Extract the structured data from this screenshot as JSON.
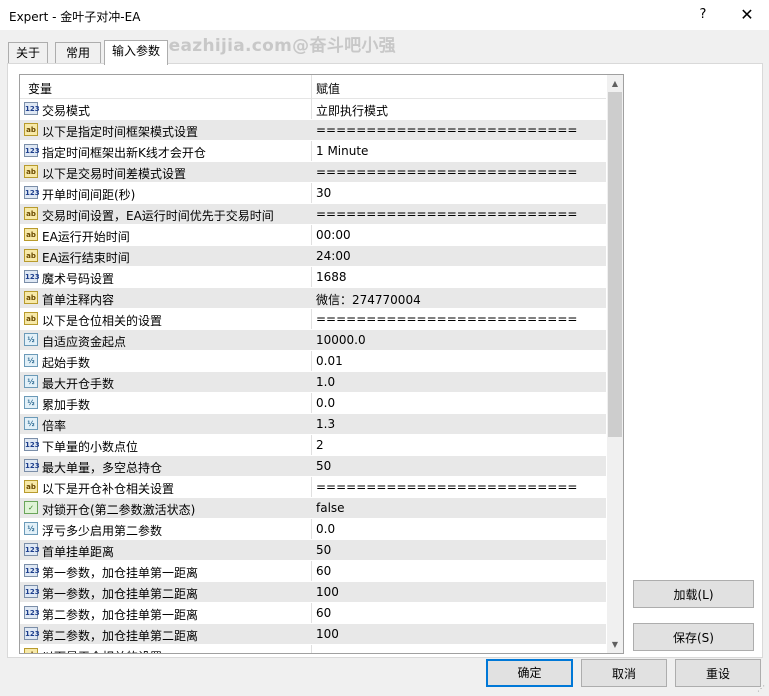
{
  "window": {
    "title": "Expert - 金叶子对冲-EA",
    "help_glyph": "?",
    "close_glyph": "✕",
    "watermark": "www.eazhijia.com@奋斗吧小强"
  },
  "tabs": [
    {
      "label": "关于"
    },
    {
      "label": "常用"
    },
    {
      "label": "输入参数"
    }
  ],
  "grid": {
    "col_variable": "变量",
    "col_value": "赋值",
    "rows": [
      {
        "icon": "123",
        "name": "交易模式",
        "value": "立即执行模式"
      },
      {
        "icon": "ab",
        "name": "以下是指定时间框架模式设置",
        "value": "=========================="
      },
      {
        "icon": "123",
        "name": "指定时间框架出新K线才会开仓",
        "value": "1 Minute"
      },
      {
        "icon": "ab",
        "name": "以下是交易时间差模式设置",
        "value": "=========================="
      },
      {
        "icon": "123",
        "name": "开单时间间距(秒)",
        "value": "30"
      },
      {
        "icon": "ab",
        "name": "交易时间设置，EA运行时间优先于交易时间",
        "value": "=========================="
      },
      {
        "icon": "ab",
        "name": "EA运行开始时间",
        "value": "00:00"
      },
      {
        "icon": "ab",
        "name": "EA运行结束时间",
        "value": "24:00"
      },
      {
        "icon": "123",
        "name": "魔术号码设置",
        "value": "1688"
      },
      {
        "icon": "ab",
        "name": "首单注释内容",
        "value": "微信：274770004"
      },
      {
        "icon": "ab",
        "name": "以下是仓位相关的设置",
        "value": "=========================="
      },
      {
        "icon": "v2",
        "name": "自适应资金起点",
        "value": "10000.0"
      },
      {
        "icon": "v2",
        "name": "起始手数",
        "value": "0.01"
      },
      {
        "icon": "v2",
        "name": "最大开仓手数",
        "value": "1.0"
      },
      {
        "icon": "v2",
        "name": "累加手数",
        "value": "0.0"
      },
      {
        "icon": "v2",
        "name": "倍率",
        "value": "1.3"
      },
      {
        "icon": "123",
        "name": "下单量的小数点位",
        "value": "2"
      },
      {
        "icon": "123",
        "name": "最大单量，多空总持仓",
        "value": "50"
      },
      {
        "icon": "ab",
        "name": "以下是开仓补仓相关设置",
        "value": "=========================="
      },
      {
        "icon": "bool",
        "name": "对锁开仓(第二参数激活状态)",
        "value": "false"
      },
      {
        "icon": "v2",
        "name": "浮亏多少启用第二参数",
        "value": "0.0"
      },
      {
        "icon": "123",
        "name": "首单挂单距离",
        "value": "50"
      },
      {
        "icon": "123",
        "name": "第一参数，加仓挂单第一距离",
        "value": "60"
      },
      {
        "icon": "123",
        "name": "第一参数，加仓挂单第二距离",
        "value": "100"
      },
      {
        "icon": "123",
        "name": "第二参数，加仓挂单第一距离",
        "value": "60"
      },
      {
        "icon": "123",
        "name": "第二参数，加仓挂单第二距离",
        "value": "100"
      },
      {
        "icon": "ab",
        "name": "以下是平仓相关的设置",
        "value": ""
      }
    ]
  },
  "scroll": {
    "up": "▲",
    "down": "▼"
  },
  "buttons": {
    "load": "加载(L)",
    "save": "保存(S)",
    "ok": "确定",
    "cancel": "取消",
    "reset": "重设"
  },
  "icon_labels": {
    "123": "123",
    "ab": "ab",
    "v2": "½",
    "bool": "✓"
  }
}
